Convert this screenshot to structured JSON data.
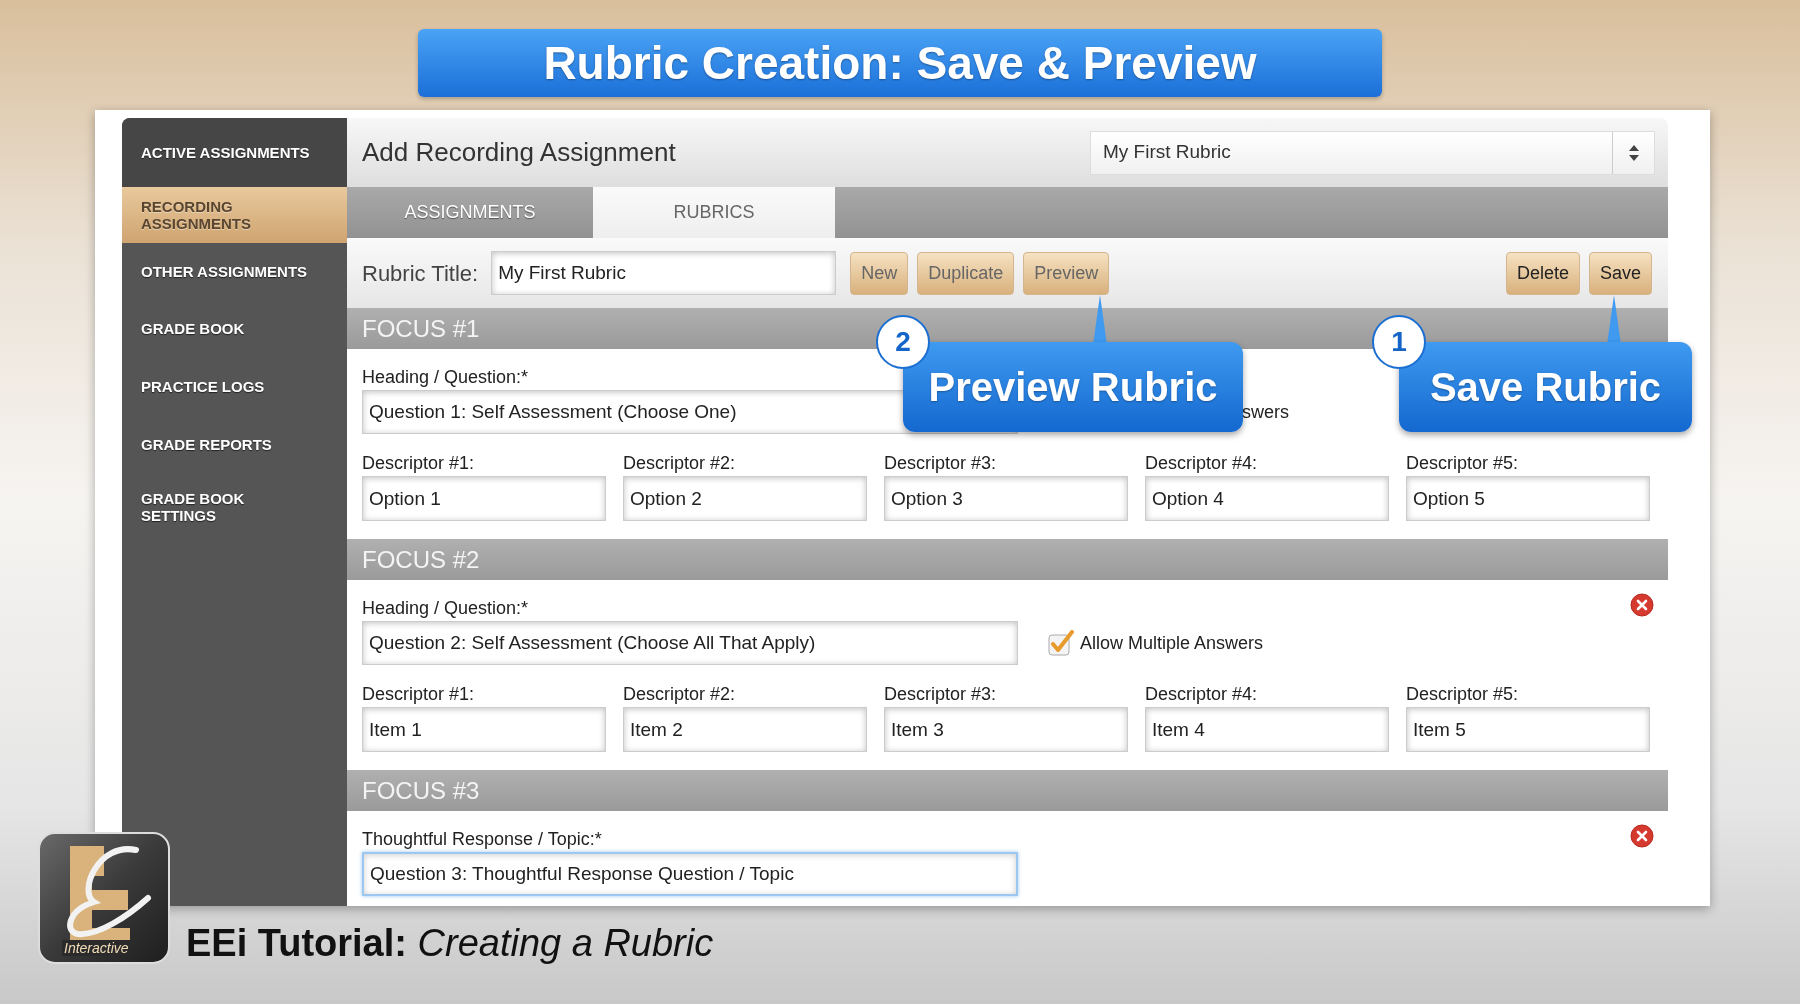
{
  "slide_title": "Rubric Creation: Save & Preview",
  "sidebar": {
    "items": [
      {
        "label": "ACTIVE ASSIGNMENTS",
        "selected": false
      },
      {
        "label": "RECORDING ASSIGNMENTS",
        "selected": true
      },
      {
        "label": "OTHER ASSIGNMENTS",
        "selected": false
      },
      {
        "label": "GRADE BOOK",
        "selected": false
      },
      {
        "label": "PRACTICE LOGS",
        "selected": false
      },
      {
        "label": "GRADE REPORTS",
        "selected": false
      },
      {
        "label": "GRADE BOOK SETTINGS",
        "selected": false
      }
    ]
  },
  "header": {
    "title": "Add Recording Assignment",
    "rubric_select": {
      "value": "My First Rubric"
    }
  },
  "tabs": [
    {
      "label": "ASSIGNMENTS",
      "selected": false
    },
    {
      "label": "RUBRICS",
      "selected": true
    }
  ],
  "rubric_title": {
    "label": "Rubric Title:",
    "value": "My First Rubric"
  },
  "toolbar": {
    "left": [
      "New",
      "Duplicate",
      "Preview"
    ],
    "right": [
      "Delete",
      "Save"
    ]
  },
  "focuses": [
    {
      "title": "FOCUS #1",
      "removable": false,
      "question_label": "Heading / Question:*",
      "question": "Question 1: Self Assessment (Choose One)",
      "focused": false,
      "allow_multiple": {
        "label": "swers"
      },
      "descriptors": [
        {
          "label": "Descriptor #1:",
          "value": "Option 1"
        },
        {
          "label": "Descriptor #2:",
          "value": "Option 2"
        },
        {
          "label": "Descriptor #3:",
          "value": "Option 3"
        },
        {
          "label": "Descriptor #4:",
          "value": "Option 4"
        },
        {
          "label": "Descriptor #5:",
          "value": "Option 5"
        }
      ]
    },
    {
      "title": "FOCUS #2",
      "removable": true,
      "question_label": "Heading / Question:*",
      "question": "Question 2: Self Assessment (Choose All That Apply)",
      "focused": false,
      "allow_multiple": {
        "label": "Allow Multiple Answers",
        "checked": true
      },
      "descriptors": [
        {
          "label": "Descriptor #1:",
          "value": "Item 1"
        },
        {
          "label": "Descriptor #2:",
          "value": "Item 2"
        },
        {
          "label": "Descriptor #3:",
          "value": "Item 3"
        },
        {
          "label": "Descriptor #4:",
          "value": "Item 4"
        },
        {
          "label": "Descriptor #5:",
          "value": "Item 5"
        }
      ]
    },
    {
      "title": "FOCUS #3",
      "removable": true,
      "question_label": "Thoughtful Response / Topic:*",
      "question": "Question 3: Thoughtful Response Question / Topic",
      "focused": true
    }
  ],
  "callouts": [
    {
      "number": "2",
      "text": "Preview Rubric"
    },
    {
      "number": "1",
      "text": "Save Rubric"
    }
  ],
  "footer": {
    "caption": "**EEi Tutorial:** *Creating a Rubric*",
    "logo_text": "Interactive"
  }
}
